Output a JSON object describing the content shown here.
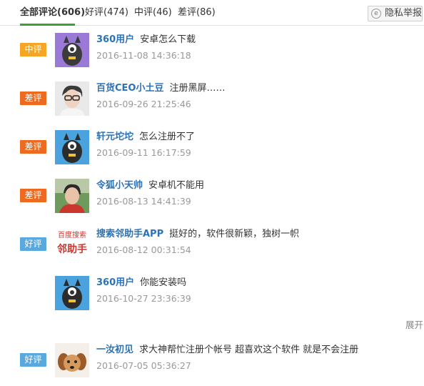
{
  "tabs": [
    {
      "label": "全部评论(606)",
      "active": true
    },
    {
      "label": "好评(474)"
    },
    {
      "label": "中评(46)"
    },
    {
      "label": "差评(86)"
    }
  ],
  "report": {
    "label": "隐私举报",
    "icon": "privacy-icon"
  },
  "reviews": [
    {
      "badge": "中评",
      "badge_type": "mid",
      "user": "360用户",
      "comment": "安卓怎么下载",
      "date": "2016-11-08 14:36:18",
      "avatar": "monster-purple"
    },
    {
      "badge": "差评",
      "badge_type": "bad",
      "user": "百货CEO小土豆",
      "comment": "注册黑屏……",
      "date": "2016-09-26 21:25:46",
      "avatar": "photo-man"
    },
    {
      "badge": "差评",
      "badge_type": "bad",
      "user": "轩元坨坨",
      "comment": "怎么注册不了",
      "date": "2016-09-11 16:17:59",
      "avatar": "monster-blue"
    },
    {
      "badge": "差评",
      "badge_type": "bad",
      "user": "令狐小天帅",
      "comment": "安卓机不能用",
      "date": "2016-08-13 14:41:39",
      "avatar": "photo-man2"
    },
    {
      "badge": "好评",
      "badge_type": "good",
      "user": "搜索邻助手APP",
      "comment": "挺好的，软件很新颖，独树一帜",
      "date": "2016-08-12 00:31:54",
      "avatar": "logo-text",
      "avatar_text_top": "百度搜索",
      "avatar_text_bottom": "邻助手"
    },
    {
      "badge": "",
      "badge_type": "",
      "user": "360用户",
      "comment": "你能安装吗",
      "date": "2016-10-27 23:36:39",
      "avatar": "monster-blue"
    },
    {
      "badge": "好评",
      "badge_type": "good",
      "user": "一汝初见",
      "comment": "求大神帮忙注册个帐号 超喜欢这个软件 就是不会注册",
      "date": "2016-07-05 05:36:27",
      "avatar": "dog"
    }
  ],
  "expand_label": "展开"
}
